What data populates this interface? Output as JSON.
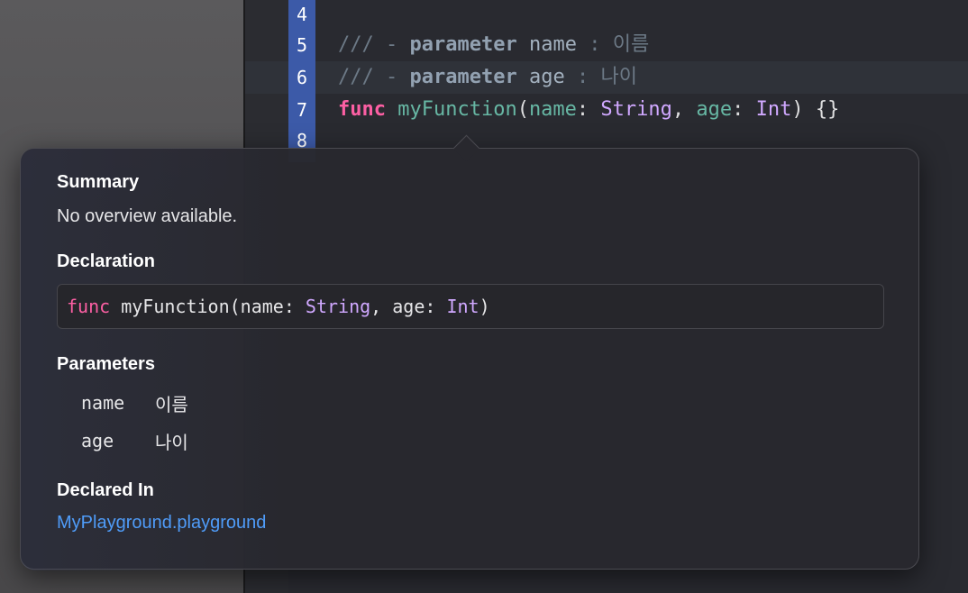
{
  "editor": {
    "line_numbers": [
      "4",
      "5",
      "6",
      "7",
      "8"
    ],
    "lines": {
      "l5": {
        "comment": "///",
        "dash": "-",
        "keyword": "parameter",
        "param": "name",
        "colon": ":",
        "desc": "이름"
      },
      "l6": {
        "comment": "///",
        "dash": "-",
        "keyword": "parameter",
        "param": "age",
        "colon": ":",
        "desc": "나이"
      },
      "l7": {
        "kw": "func",
        "name": "myFunction",
        "open": "(",
        "p1": "name",
        "c1": ": ",
        "t1": "String",
        "sep": ", ",
        "p2": "age",
        "c2": ": ",
        "t2": "Int",
        "close": ") {}"
      }
    }
  },
  "quick_help": {
    "summary_title": "Summary",
    "summary_text": "No overview available.",
    "declaration_title": "Declaration",
    "declaration": {
      "kw": "func",
      "rest1": " myFunction(name: ",
      "t1": "String",
      "rest2": ", age: ",
      "t2": "Int",
      "rest3": ")"
    },
    "parameters_title": "Parameters",
    "parameters": [
      {
        "name": "name",
        "desc": "이름"
      },
      {
        "name": "age",
        "desc": "나이"
      }
    ],
    "declared_in_title": "Declared In",
    "declared_in_link": "MyPlayground.playground"
  },
  "colors": {
    "keyword": "#fc5fa3",
    "type": "#d0a8ff",
    "function": "#67b7a4",
    "comment": "#6c7986",
    "link": "#4f9cf9",
    "line_number_highlight": "#3c5aa8"
  }
}
